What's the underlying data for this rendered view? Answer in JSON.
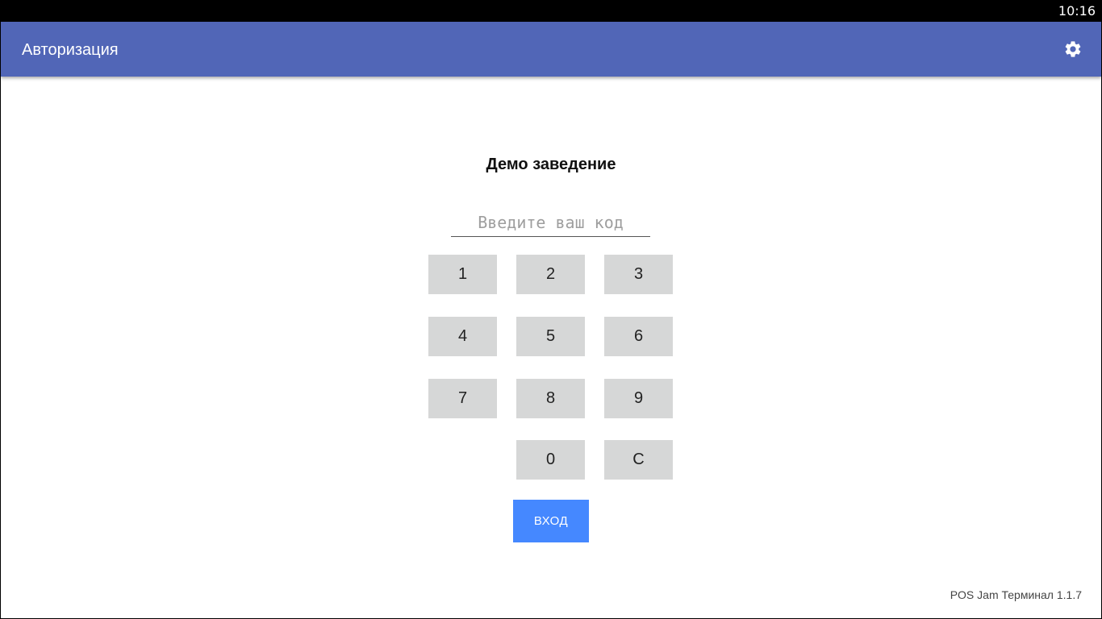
{
  "status_bar": {
    "time": "10:16"
  },
  "app_bar": {
    "title": "Авторизация",
    "settings_icon": "gear-icon",
    "color": "#5166b7"
  },
  "main": {
    "venue_name": "Демо заведение",
    "code_input": {
      "value": "",
      "placeholder": "Введите ваш код"
    },
    "keypad": {
      "keys": [
        "1",
        "2",
        "3",
        "4",
        "5",
        "6",
        "7",
        "8",
        "9",
        "0",
        "C"
      ],
      "key_color": "#d6d7d7"
    },
    "login_button": {
      "label": "ВХОД",
      "color": "#4588ff"
    }
  },
  "footer": {
    "version": "POS Jam Терминал 1.1.7"
  }
}
